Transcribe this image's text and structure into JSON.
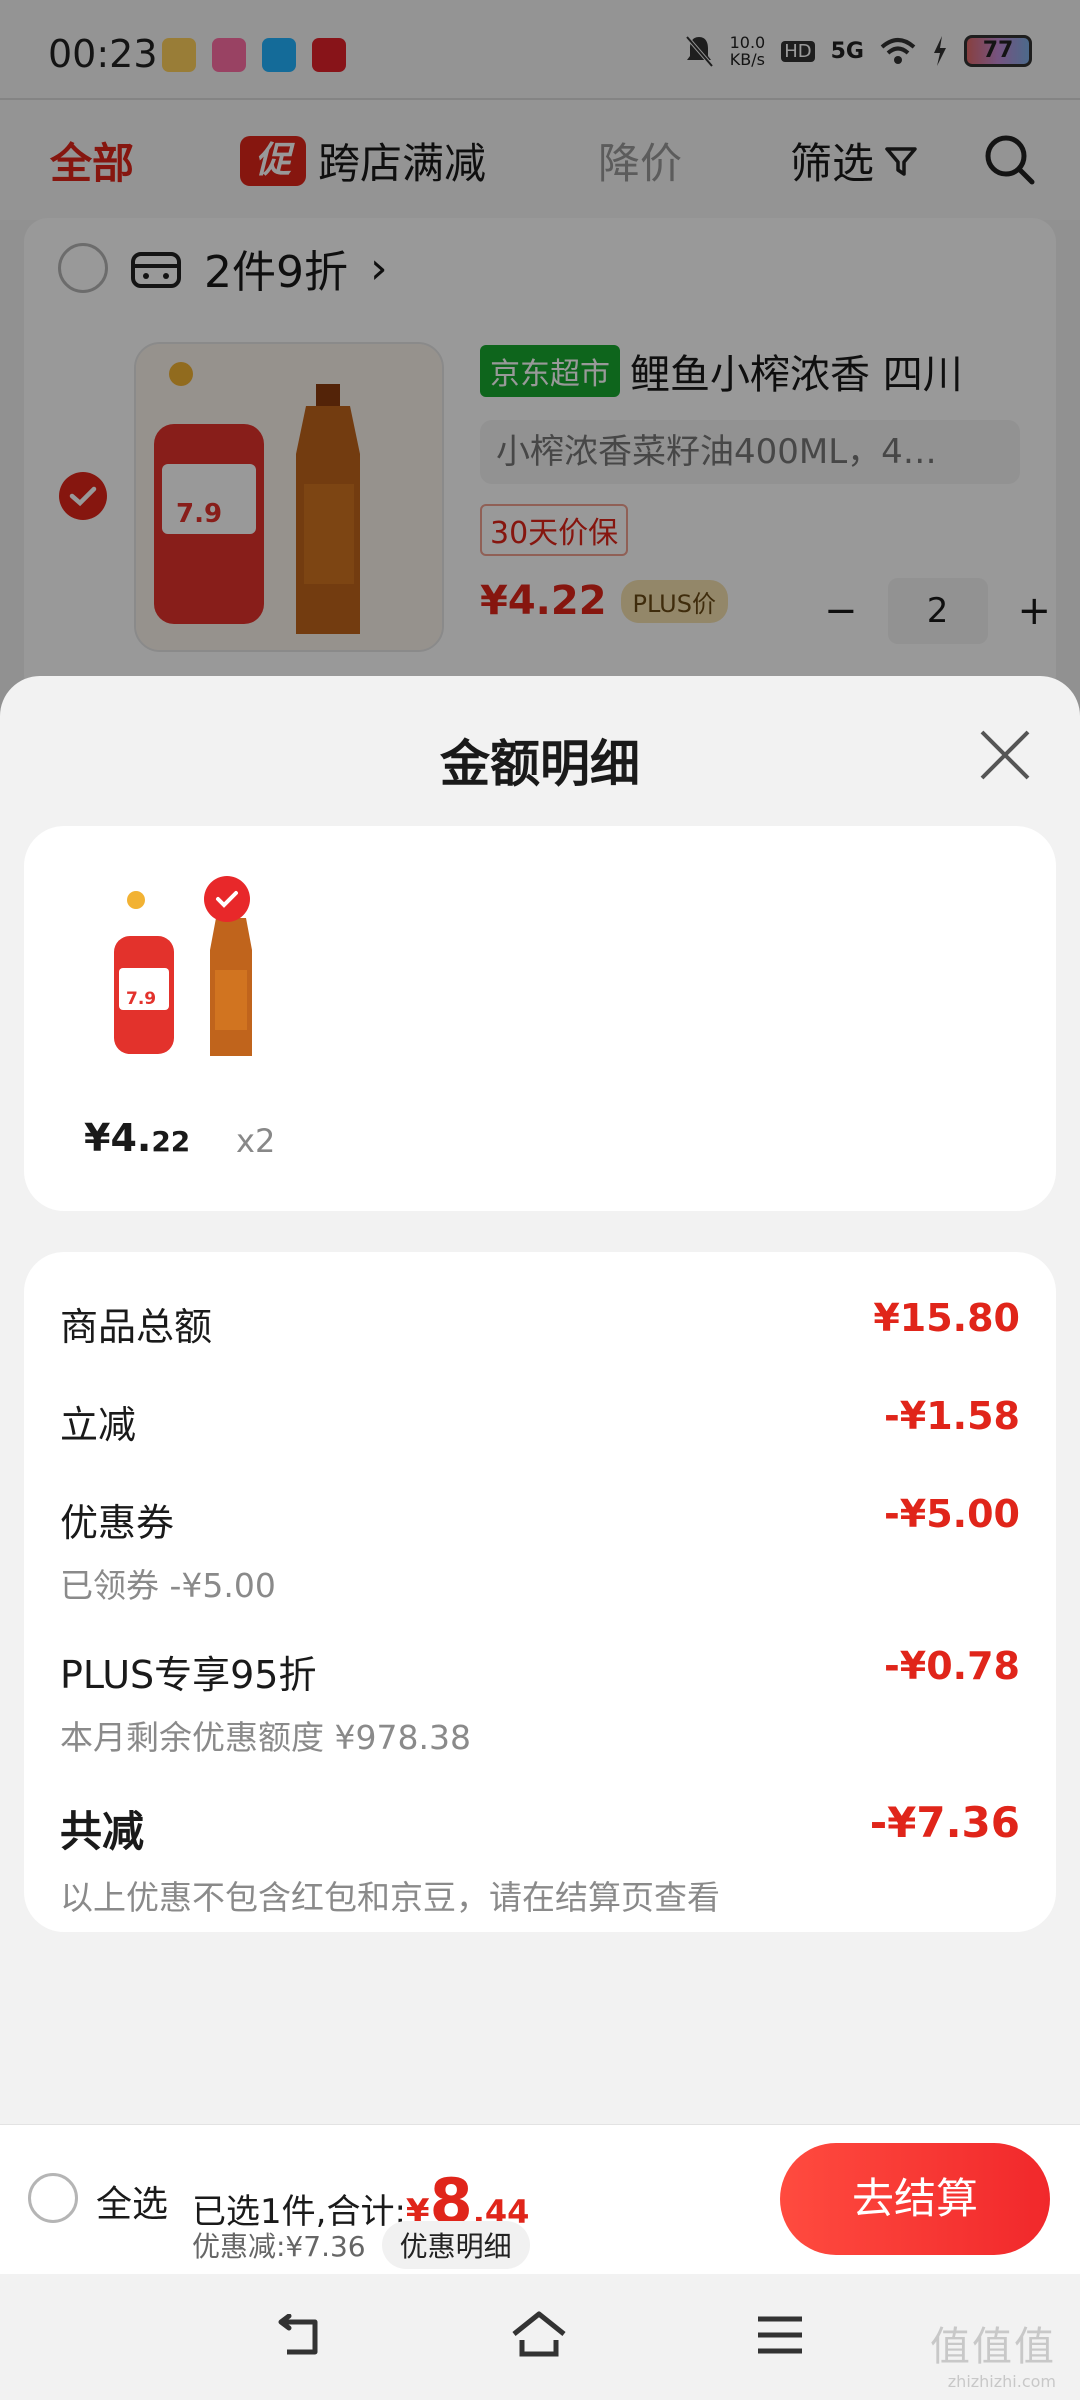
{
  "status_bar": {
    "time": "00:23",
    "net_speed": "10.0",
    "net_unit": "KB/s",
    "hd": "HD",
    "network": "5G",
    "battery": "77"
  },
  "filter_bar": {
    "all": "全部",
    "promo_badge": "促",
    "cross_store": "跨店满减",
    "price_drop": "降价",
    "filter": "筛选"
  },
  "cart": {
    "store_promo": "2件9折",
    "store_chevron": "›",
    "jd_tag": "京东超市",
    "product_title": "鲤鱼小榨浓香 四川",
    "spec": "小榨浓香菜籽油400ML，4…",
    "guarantee": "30天价保",
    "price": "¥4.22",
    "plus_tag": "PLUS价",
    "quantity": "2",
    "minus": "−",
    "plus": "+"
  },
  "sheet": {
    "title": "金额明细",
    "item": {
      "price_main": "¥4.",
      "price_decimal": "22",
      "qty": "x2"
    },
    "rows": {
      "goods_total": {
        "label": "商品总额",
        "value": "¥15.80"
      },
      "instant": {
        "label": "立减",
        "value": "-¥1.58"
      },
      "coupon": {
        "label": "优惠券",
        "value": "-¥5.00",
        "sub": "已领券 -¥5.00"
      },
      "plus95": {
        "label": "PLUS专享95折",
        "value": "-¥0.78",
        "sub": "本月剩余优惠额度 ¥978.38"
      },
      "total_reduce": {
        "label": "共减",
        "value": "-¥7.36",
        "sub": "以上优惠不包含红包和京豆，请在结算页查看"
      }
    }
  },
  "checkout": {
    "select_all": "全选",
    "selected_text": "已选1件,合计:",
    "currency": "¥",
    "total_int": "8",
    "total_dec": ".44",
    "discount_text": "优惠减:¥7.36",
    "detail_btn": "优惠明细",
    "checkout_btn": "去结算"
  },
  "watermark": {
    "text": "值值值",
    "url": "zhizhizhi.com"
  },
  "colors": {
    "accent": "#e0251a",
    "jd_green": "#18a82f",
    "plus_gold": "#f5e1b0"
  }
}
